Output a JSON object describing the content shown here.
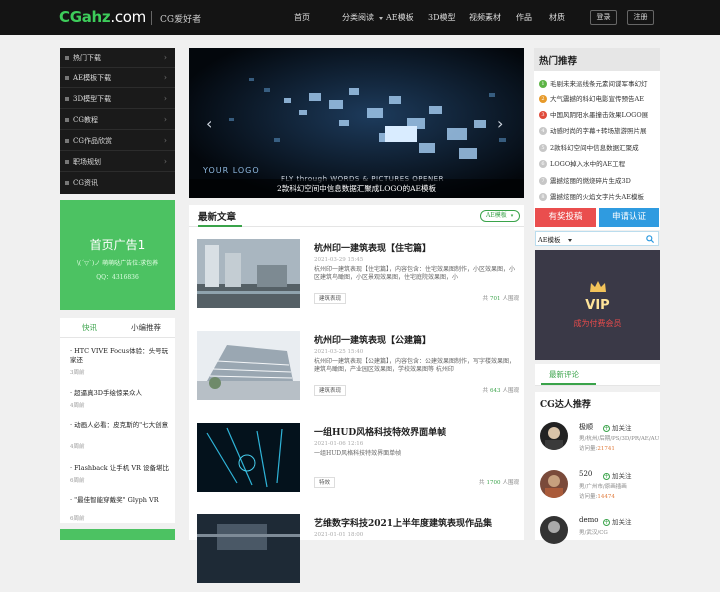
{
  "header": {
    "logo_main": "CGahz",
    "logo_suffix": ".com",
    "logo_sub": "CG爱好者",
    "nav": [
      "首页",
      "分类阅读",
      "AE模板",
      "3D模型",
      "视频素材",
      "作品",
      "材质"
    ],
    "login": "登录",
    "register": "注册"
  },
  "left_menu": [
    "热门下载",
    "AE模板下载",
    "3D模型下载",
    "CG教程",
    "CG作品欣赏",
    "职场规划",
    "CG资讯"
  ],
  "home_ad": {
    "title": "首页广告1",
    "subtitle": "\\(´▽`)ノ 萌萌哒广告位:求包养",
    "qq": "QQ：4316836"
  },
  "news": {
    "tabs": [
      "快讯",
      "小编推荐"
    ],
    "items": [
      {
        "title": "· HTC VIVE Focus体验：头号玩家还",
        "time": "3周前"
      },
      {
        "title": "· 超逼真3D手绘惊呆众人",
        "time": "4周前"
      },
      {
        "title": "· 动画人必看：皮克斯的\"七大创意",
        "time": "4周前"
      },
      {
        "title": "· Flashback 让手机 VR 设备堪比",
        "time": "6周前"
      },
      {
        "title": "· \"最佳智能穿戴奖\" Glyph VR",
        "time": "6周前"
      }
    ]
  },
  "slider": {
    "caption": "2款科幻空间中信息数据汇聚成LOGO的AE模板",
    "overlay": "FLY through WORDS & PICTURES OPENER",
    "logo_text": "YOUR LOGO",
    "prev": "‹",
    "next": "›"
  },
  "latest": {
    "heading": "最新文章",
    "filter": "AE模板",
    "articles": [
      {
        "title": "杭州印一建筑表现【住宅篇】",
        "time": "2021-03-29 15:45",
        "desc": "杭州印一建筑表现【住宅篇】，内容包含：住宅效果图制作，小区效果图，小区建筑鸟瞰图，小区景观效果图，住宅庭院效果图，小",
        "tag": "建筑表现",
        "prefix": "共",
        "count": "701",
        "suffix": "人围观"
      },
      {
        "title": "杭州印一建筑表现【公建篇】",
        "time": "2021-03-25 15:40",
        "desc": "杭州印一建筑表现【公建篇】，内容包含：公建效果图制作，写字楼效果图，建筑鸟瞰图，产业园区效果图，学校效果图等 杭州印",
        "tag": "建筑表现",
        "prefix": "共",
        "count": "643",
        "suffix": "人围观"
      },
      {
        "title": "一组HUD风格科技特效界面单帧",
        "time": "2021-01-06 12:16",
        "desc": "一组HUD风格科技特效界面单帧",
        "tag": "特效",
        "prefix": "共",
        "count": "1700",
        "suffix": "人围观"
      },
      {
        "title": "艺维数字科技2021上半年度建筑表现作品集",
        "time": "2021-01-01 18:00",
        "desc": "",
        "tag": "",
        "prefix": "",
        "count": "",
        "suffix": ""
      }
    ]
  },
  "hot": {
    "heading": "热门推荐",
    "items": [
      "毛剔未来派线条元素间谍军事幻灯",
      "大气震撼的科幻电影宣传预告AE",
      "中国风阴阳水墨撞击效果LOGO展",
      "动感时尚的字幕+转场旅游照片展",
      "2款科幻空间中信息数据汇聚成",
      "LOGO掉入水中的AE工程",
      "震撼炫丽的燃烧碎片生成3D",
      "震撼炫丽的火焰文字片头AE模板"
    ],
    "num_colors": [
      "#5db445",
      "#e79a2a",
      "#e04a3a",
      "#c7c7c7"
    ]
  },
  "buttons": {
    "submit": "有奖投稿",
    "certify": "申请认证"
  },
  "search": {
    "category": "AE模板",
    "placeholder": ""
  },
  "vip": {
    "title": "VIP",
    "subtitle": "成为付费会员"
  },
  "comments": {
    "tab": "最新评论"
  },
  "experts": {
    "heading": "CG达人推荐",
    "follow": "加关注",
    "users": [
      {
        "name": "极顺",
        "info": "男/杭州/后期/PS/3D/PR/AE/AU",
        "visits_label": "访问量:",
        "visits": "21741"
      },
      {
        "name": "520",
        "info": "男/广州市/原画插画",
        "visits_label": "访问量:",
        "visits": "14474"
      },
      {
        "name": "demo",
        "info": "男/武汉/CG",
        "visits_label": "",
        "visits": ""
      }
    ]
  }
}
